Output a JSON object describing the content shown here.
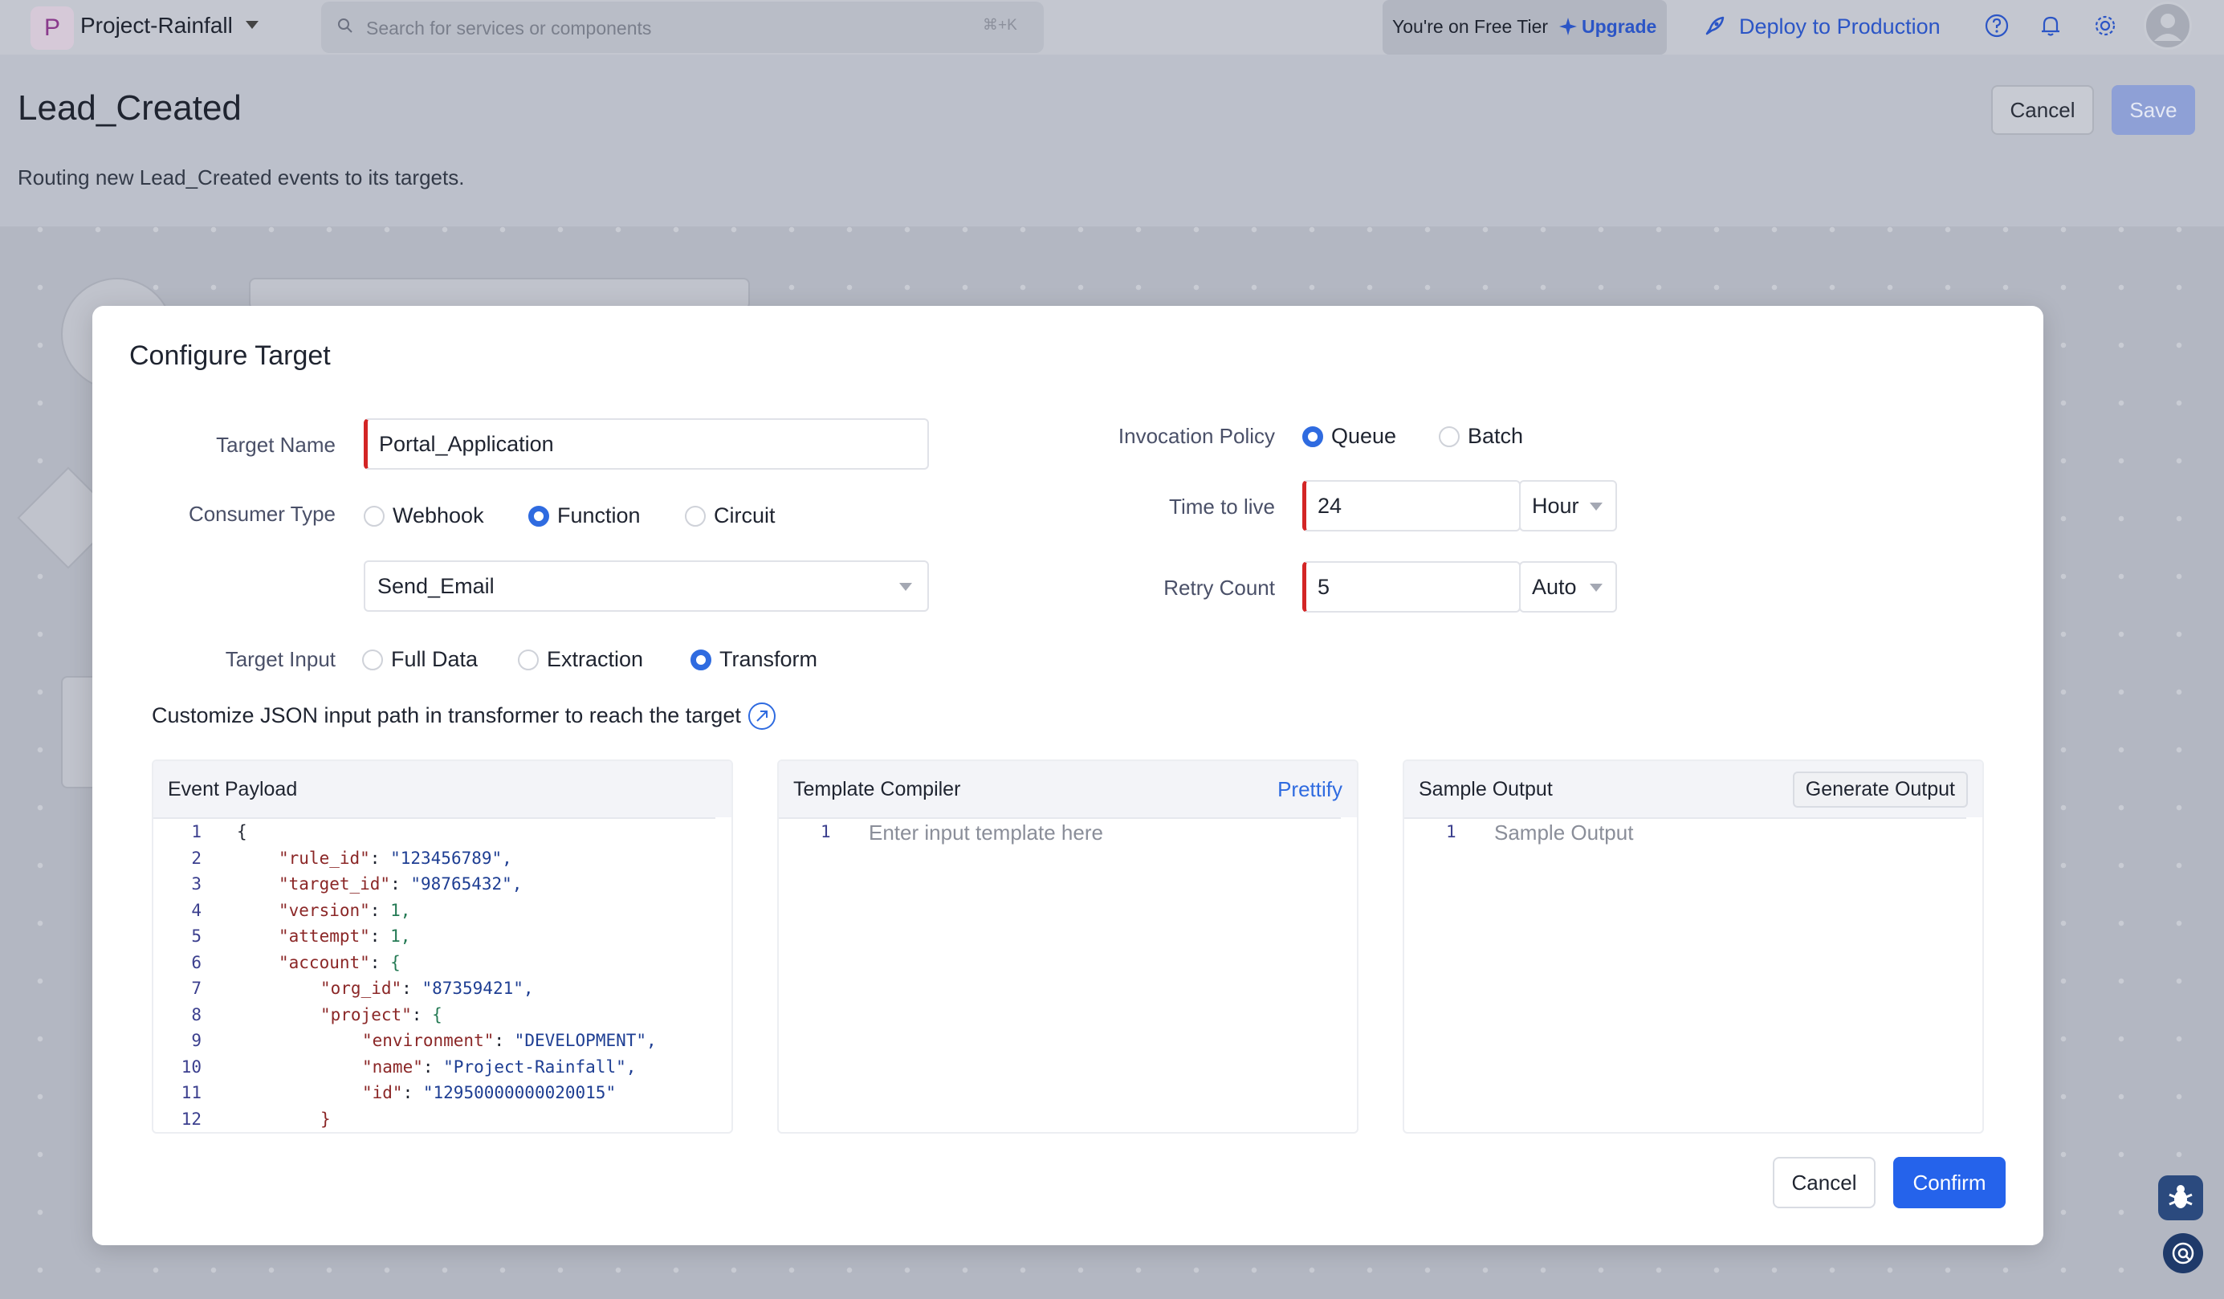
{
  "topbar": {
    "project_initial": "P",
    "project_name": "Project-Rainfall",
    "search_placeholder": "Search for services or components",
    "search_shortcut": "⌘+K",
    "tier_text": "You're on Free Tier",
    "upgrade_label": "Upgrade",
    "deploy_label": "Deploy to Production"
  },
  "header": {
    "title": "Lead_Created",
    "subtitle": "Routing new Lead_Created events to its targets.",
    "cancel_label": "Cancel",
    "save_label": "Save"
  },
  "modal": {
    "title": "Configure Target",
    "target_name": {
      "label": "Target Name",
      "value": "Portal_Application"
    },
    "consumer_type": {
      "label": "Consumer Type",
      "options": [
        "Webhook",
        "Function",
        "Circuit"
      ],
      "selected": "Function"
    },
    "function_select": {
      "value": "Send_Email"
    },
    "target_input": {
      "label": "Target Input",
      "options": [
        "Full Data",
        "Extraction",
        "Transform"
      ],
      "selected": "Transform"
    },
    "invocation_policy": {
      "label": "Invocation Policy",
      "options": [
        "Queue",
        "Batch"
      ],
      "selected": "Queue"
    },
    "time_to_live": {
      "label": "Time to live",
      "value": "24",
      "unit": "Hour"
    },
    "retry_count": {
      "label": "Retry Count",
      "value": "5",
      "mode": "Auto"
    },
    "hint": "Customize JSON input path in transformer to reach the target",
    "event_payload": {
      "title": "Event Payload",
      "lines": [
        {
          "n": "1",
          "indent": 0,
          "key": "",
          "val": "{",
          "type": "pun"
        },
        {
          "n": "2",
          "indent": 1,
          "key": "\"rule_id\"",
          "val": "\"123456789\",",
          "type": "sv"
        },
        {
          "n": "3",
          "indent": 1,
          "key": "\"target_id\"",
          "val": "\"98765432\",",
          "type": "sv"
        },
        {
          "n": "4",
          "indent": 1,
          "key": "\"version\"",
          "val": "1,",
          "type": "nv"
        },
        {
          "n": "5",
          "indent": 1,
          "key": "\"attempt\"",
          "val": "1,",
          "type": "nv"
        },
        {
          "n": "6",
          "indent": 1,
          "key": "\"account\"",
          "val": "{",
          "type": "pun"
        },
        {
          "n": "7",
          "indent": 2,
          "key": "\"org_id\"",
          "val": "\"87359421\",",
          "type": "sv"
        },
        {
          "n": "8",
          "indent": 2,
          "key": "\"project\"",
          "val": "{",
          "type": "pun"
        },
        {
          "n": "9",
          "indent": 3,
          "key": "\"environment\"",
          "val": "\"DEVELOPMENT\",",
          "type": "sv"
        },
        {
          "n": "10",
          "indent": 3,
          "key": "\"name\"",
          "val": "\"Project-Rainfall\",",
          "type": "sv"
        },
        {
          "n": "11",
          "indent": 3,
          "key": "\"id\"",
          "val": "\"12950000000020015\"",
          "type": "sv"
        },
        {
          "n": "12",
          "indent": 2,
          "key": "",
          "val": "}",
          "type": "kw"
        }
      ]
    },
    "template_compiler": {
      "title": "Template Compiler",
      "prettify_label": "Prettify",
      "line_number": "1",
      "placeholder": "Enter input template here"
    },
    "sample_output": {
      "title": "Sample Output",
      "generate_label": "Generate Output",
      "line_number": "1",
      "placeholder": "Sample Output"
    },
    "cancel_label": "Cancel",
    "confirm_label": "Confirm"
  },
  "colors": {
    "accent": "#2563eb",
    "required_marker": "#d32525",
    "link": "#2b55c6"
  },
  "icons": [
    "search-icon",
    "sparkle-icon",
    "rocket-icon",
    "help-icon",
    "bell-icon",
    "gear-icon",
    "user-avatar-icon",
    "external-link-icon",
    "bug-icon",
    "support-icon"
  ]
}
